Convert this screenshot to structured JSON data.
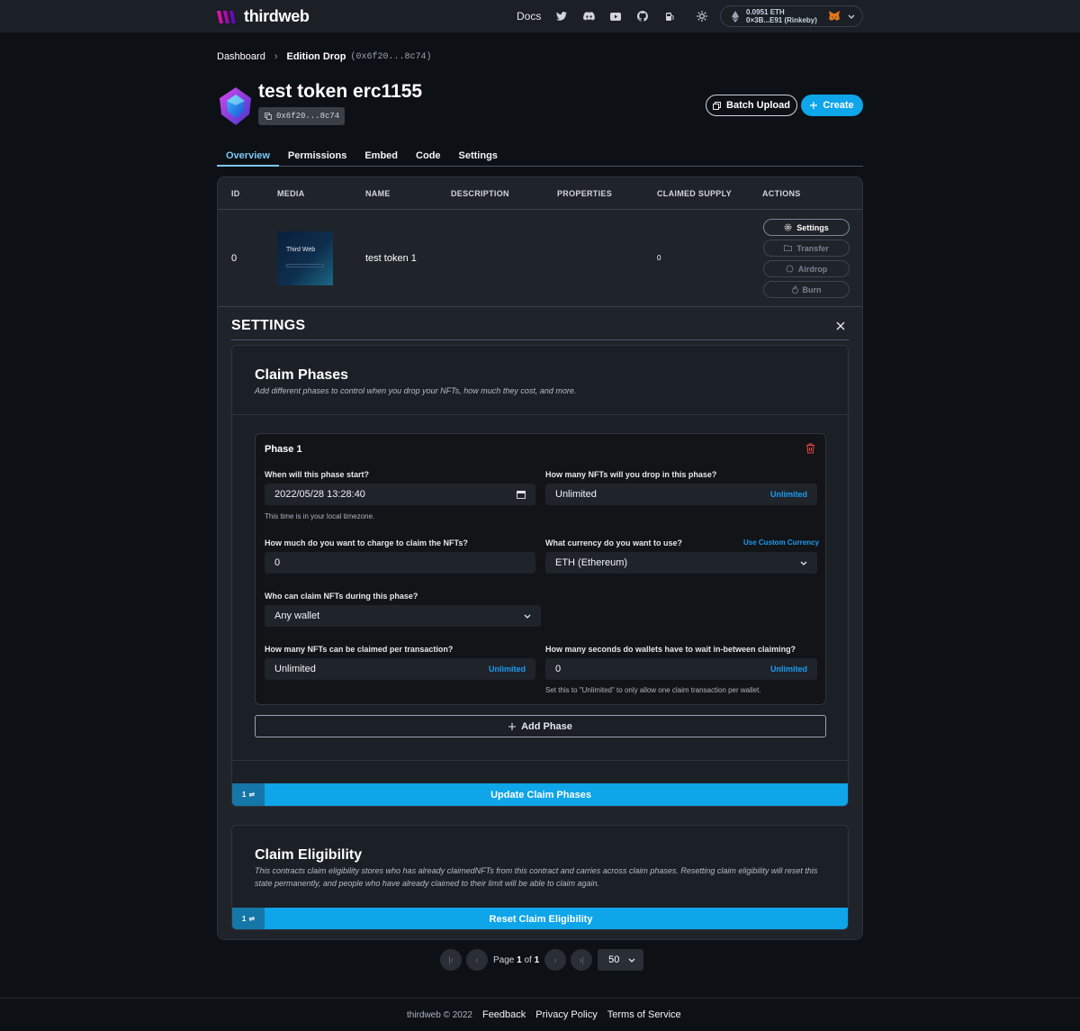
{
  "nav": {
    "brand": "thirdweb",
    "docs": "Docs",
    "icons": [
      "twitter-icon",
      "discord-icon",
      "youtube-icon",
      "github-icon",
      "gas-pump-icon",
      "sun-icon"
    ],
    "wallet": {
      "balance": "0.0951 ETH",
      "address": "0×3B...E91 (Rinkeby)"
    }
  },
  "breadcrumb": {
    "root": "Dashboard",
    "current": "Edition Drop",
    "address": "(0x6f20...8c74)"
  },
  "contract": {
    "title": "test token erc1155",
    "address": "0x6f20...8c74"
  },
  "header_actions": {
    "batch_upload": "Batch Upload",
    "create": "Create"
  },
  "tabs": [
    {
      "label": "Overview",
      "active": true
    },
    {
      "label": "Permissions"
    },
    {
      "label": "Embed"
    },
    {
      "label": "Code"
    },
    {
      "label": "Settings"
    }
  ],
  "table": {
    "headers": [
      "ID",
      "MEDIA",
      "NAME",
      "DESCRIPTION",
      "PROPERTIES",
      "CLAIMED SUPPLY",
      "ACTIONS"
    ],
    "rows": [
      {
        "id": "0",
        "media_text": "Third Web",
        "name": "test token 1",
        "description": "",
        "properties": "",
        "claimed_supply": "0"
      }
    ],
    "actions": [
      "Settings",
      "Transfer",
      "Airdrop",
      "Burn"
    ]
  },
  "settings": {
    "title": "SETTINGS",
    "claim_phases": {
      "title": "Claim Phases",
      "subtitle": "Add different phases to control when you drop your NFTs, how much they cost, and more.",
      "phase": {
        "title": "Phase 1",
        "start_label": "When will this phase start?",
        "start_value": "2022/05/28 13:28:40",
        "start_help": "This time is in your local timezone.",
        "drop_label": "How many NFTs will you drop in this phase?",
        "drop_value": "Unlimited",
        "drop_suffix": "Unlimited",
        "price_label": "How much do you want to charge to claim the NFTs?",
        "price_value": "0",
        "currency_label": "What currency do you want to use?",
        "currency_link": "Use Custom Currency",
        "currency_value": "ETH (Ethereum)",
        "who_label": "Who can claim NFTs during this phase?",
        "who_value": "Any wallet",
        "per_tx_label": "How many NFTs can be claimed per transaction?",
        "per_tx_value": "Unlimited",
        "per_tx_suffix": "Unlimited",
        "wait_label": "How many seconds do wallets have to wait in-between claiming?",
        "wait_value": "0",
        "wait_suffix": "Unlimited",
        "wait_help": "Set this to \"Unlimited\" to only allow one claim transaction per wallet."
      },
      "add_phase": "Add Phase",
      "badge": "1",
      "submit": "Update Claim Phases"
    },
    "claim_eligibility": {
      "title": "Claim Eligibility",
      "subtitle": "This contracts claim eligibility stores who has already claimedNFTs from this contract and carries across claim phases. Resetting claim eligibility will reset this state permanently, and people who have already claimed to their limit will be able to claim again.",
      "badge": "1",
      "submit": "Reset Claim Eligibility"
    }
  },
  "pagination": {
    "page_word": "Page",
    "current": "1",
    "of_word": "of",
    "total": "1",
    "page_size": "50"
  },
  "footer": {
    "copyright": "thirdweb © 2022",
    "links": [
      "Feedback",
      "Privacy Policy",
      "Terms of Service"
    ]
  },
  "colors": {
    "accent": "#0ea5e9",
    "active_tab": "#7cc9f5",
    "link": "#1b9cf0",
    "danger": "#ef4444",
    "background": "#0d1015"
  }
}
